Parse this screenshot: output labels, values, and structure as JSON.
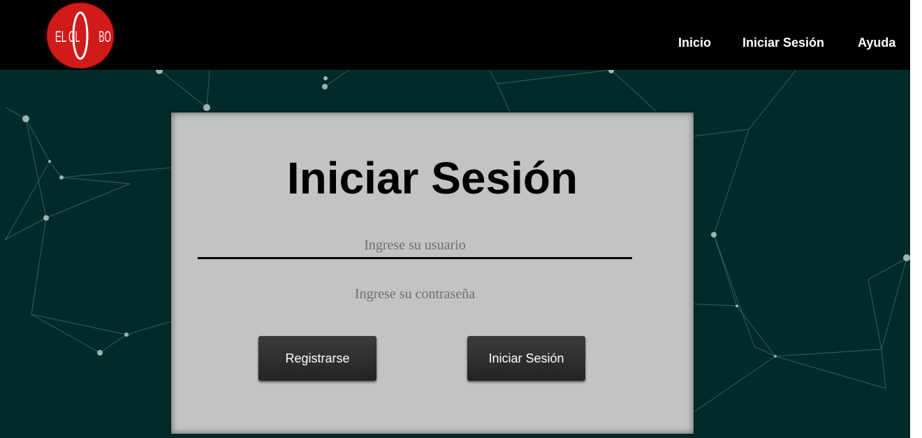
{
  "brand": {
    "logo_text": "ELGLOBO",
    "logo_color": "#d11a1a"
  },
  "nav": {
    "items": [
      {
        "label": "Inicio"
      },
      {
        "label": "Iniciar Sesión"
      },
      {
        "label": "Ayuda"
      }
    ]
  },
  "login": {
    "title": "Iniciar Sesión",
    "username_placeholder": "Ingrese su usuario",
    "username_value": "",
    "password_placeholder": "Ingrese su contraseña",
    "password_value": "",
    "register_label": "Registrarse",
    "submit_label": "Iniciar Sesión"
  },
  "colors": {
    "navbar": "#000000",
    "background": "#002b2a",
    "card": "#c2c4c3",
    "button": "#2c2c2c"
  }
}
